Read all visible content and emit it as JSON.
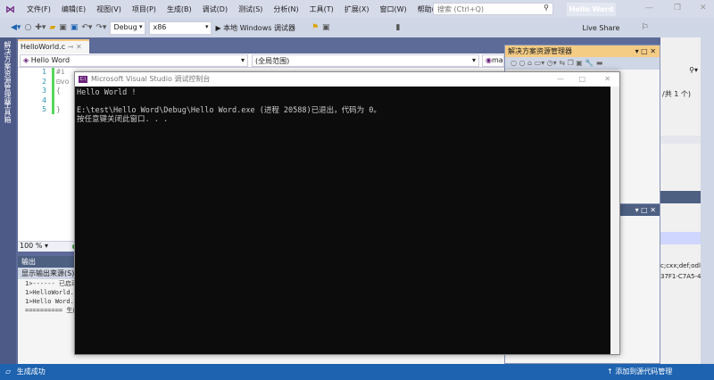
{
  "menubar": {
    "items": [
      "文件(F)",
      "编辑(E)",
      "视图(V)",
      "项目(P)",
      "生成(B)",
      "调试(D)",
      "测试(S)",
      "分析(N)",
      "工具(T)",
      "扩展(X)",
      "窗口(W)",
      "帮助(H)"
    ],
    "search_placeholder": "搜索 (Ctrl+Q)",
    "window_title": "Hello Word"
  },
  "toolbar": {
    "config": "Debug",
    "platform": "x86",
    "run_label": "▶ 本地 Windows 调试器",
    "live_share": "Live Share"
  },
  "sidebar": {
    "tabs": [
      "解决方案资源管理器",
      "工具箱"
    ]
  },
  "editor": {
    "tab": "HelloWorld.c",
    "project_combo": "Hello Word",
    "scope_combo": "(全局范围)",
    "member_combo": "ma",
    "lines": [
      "1",
      "2",
      "3",
      "4",
      "5"
    ],
    "code": [
      "#i",
      "⊟vo",
      "  {",
      "",
      "  }"
    ],
    "zoom": "100 %"
  },
  "output": {
    "title": "输出",
    "source_label": "显示输出来源(S):",
    "lines": [
      "1>------ 已启动",
      "1>HelloWorld.c",
      "1>Hello Word.vc",
      "========== 生成"
    ]
  },
  "console": {
    "title": "Microsoft Visual Studio 调试控制台",
    "icon_text": "C:\\",
    "text": "Hello World !\n\nE:\\test\\Hello Word\\Debug\\Hello Word.exe (进程 20588)已退出，代码为 0。\n按任意键关闭此窗口. . ."
  },
  "solution_explorer": {
    "title": "解决方案资源管理器",
    "count": "/共 1 个)"
  },
  "properties": {
    "line1": "c;cxx;def;odl;idl;hpj;bat;a",
    "line2": "37F1-C7A5-4376-A066-2"
  },
  "statusbar": {
    "left": "生成成功",
    "right": "↑ 添加到源代码管理"
  },
  "colors": {
    "accent": "#68217a",
    "status": "#1e63b0",
    "tool_header": "#f5cc84"
  }
}
